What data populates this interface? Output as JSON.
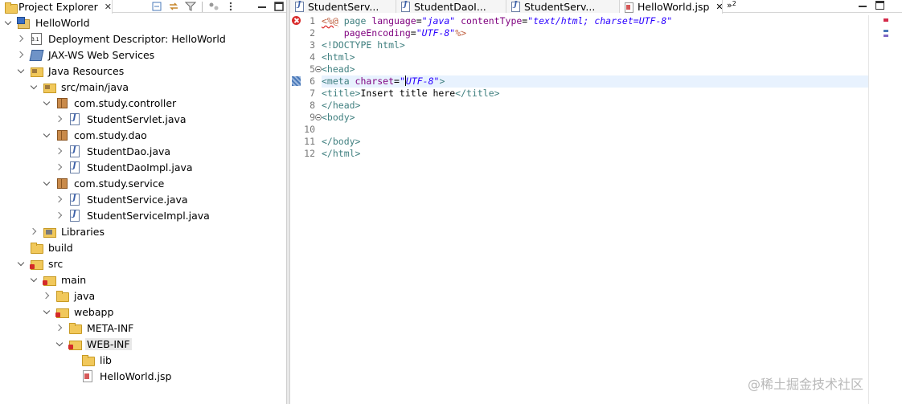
{
  "explorer": {
    "tab_label": "Project Explorer",
    "tab_close": "✕",
    "tree": [
      {
        "label": "HelloWorld",
        "icon": "project-icon",
        "depth": 0,
        "expanded": true
      },
      {
        "label": "Deployment Descriptor: HelloWorld",
        "icon": "deployment-descriptor-icon",
        "depth": 1,
        "expanded": false
      },
      {
        "label": "JAX-WS Web Services",
        "icon": "web-services-icon",
        "depth": 1,
        "expanded": false
      },
      {
        "label": "Java Resources",
        "icon": "java-resources-icon",
        "depth": 1,
        "expanded": true
      },
      {
        "label": "src/main/java",
        "icon": "source-folder-icon",
        "depth": 2,
        "expanded": true
      },
      {
        "label": "com.study.controller",
        "icon": "package-icon",
        "depth": 3,
        "expanded": true
      },
      {
        "label": "StudentServlet.java",
        "icon": "java-file-icon",
        "depth": 4,
        "expanded": false
      },
      {
        "label": "com.study.dao",
        "icon": "package-icon",
        "depth": 3,
        "expanded": true
      },
      {
        "label": "StudentDao.java",
        "icon": "java-interface-icon",
        "depth": 4,
        "expanded": false
      },
      {
        "label": "StudentDaoImpl.java",
        "icon": "java-file-icon",
        "depth": 4,
        "expanded": false
      },
      {
        "label": "com.study.service",
        "icon": "package-icon",
        "depth": 3,
        "expanded": true
      },
      {
        "label": "StudentService.java",
        "icon": "java-interface-icon",
        "depth": 4,
        "expanded": false
      },
      {
        "label": "StudentServiceImpl.java",
        "icon": "java-file-icon",
        "depth": 4,
        "expanded": false
      },
      {
        "label": "Libraries",
        "icon": "libraries-icon",
        "depth": 2,
        "expanded": false
      },
      {
        "label": "build",
        "icon": "folder-icon",
        "depth": 1,
        "expanded": null
      },
      {
        "label": "src",
        "icon": "error-folder-icon",
        "depth": 1,
        "expanded": true
      },
      {
        "label": "main",
        "icon": "error-folder-icon",
        "depth": 2,
        "expanded": true
      },
      {
        "label": "java",
        "icon": "folder-icon",
        "depth": 3,
        "expanded": false
      },
      {
        "label": "webapp",
        "icon": "error-folder-icon",
        "depth": 3,
        "expanded": true
      },
      {
        "label": "META-INF",
        "icon": "folder-icon",
        "depth": 4,
        "expanded": false
      },
      {
        "label": "WEB-INF",
        "icon": "error-folder-icon",
        "depth": 4,
        "expanded": true,
        "selected": true
      },
      {
        "label": "lib",
        "icon": "folder-icon",
        "depth": 5,
        "expanded": null
      },
      {
        "label": "HelloWorld.jsp",
        "icon": "jsp-error-file-icon",
        "depth": 5,
        "expanded": null
      }
    ]
  },
  "editor": {
    "tabs": [
      {
        "label": "StudentServ...",
        "icon": "java-file-icon",
        "active": false
      },
      {
        "label": "StudentDaoI...",
        "icon": "java-file-icon",
        "active": false
      },
      {
        "label": "StudentServ...",
        "icon": "java-file-icon",
        "active": false
      },
      {
        "label": "HelloWorld.jsp",
        "icon": "jsp-file-icon",
        "active": true,
        "close": "✕"
      }
    ],
    "overflow_label": "»",
    "overflow_count": "2",
    "line_numbers": [
      "1",
      "2",
      "3",
      "4",
      "5",
      "6",
      "7",
      "8",
      "9",
      "10",
      "11",
      "12"
    ],
    "code": {
      "l1_a": "<%@",
      "l1_b": " page ",
      "l1_c": "language",
      "l1_d": "=",
      "l1_e": "\"java\"",
      "l1_f": " contentType",
      "l1_g": "=",
      "l1_h": "\"text/html; charset=UTF-8\"",
      "l2_a": "    pageEncoding",
      "l2_b": "=",
      "l2_c": "\"UTF-8\"",
      "l2_d": "%>",
      "l3": "<!DOCTYPE html>",
      "l4": "<html>",
      "l5": "<head>",
      "l6_a": "<meta ",
      "l6_b": "charset",
      "l6_c": "=",
      "l6_d": "\"",
      "l6_e": "UTF-8\"",
      "l6_f": ">",
      "l7_a": "<title>",
      "l7_b": "Insert title here",
      "l7_c": "</title>",
      "l8": "</head>",
      "l9": "<body>",
      "l10": "",
      "l11": "</body>",
      "l12": "</html>"
    }
  },
  "watermark": "@稀土掘金技术社区",
  "colors": {
    "tag": "#3f7f7f",
    "attribute": "#7f007f",
    "string": "#2a00ff",
    "error": "#d92b2b",
    "current_line": "#e8f2fe"
  }
}
